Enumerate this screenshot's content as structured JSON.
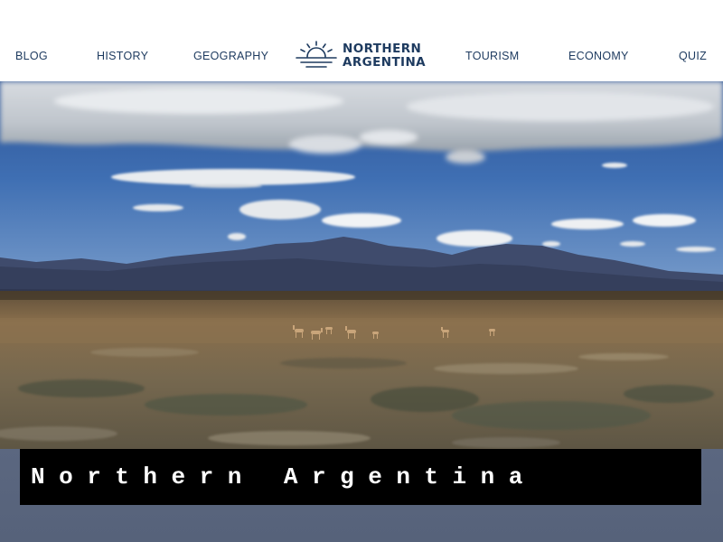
{
  "nav": {
    "blog": "BLOG",
    "history": "HISTORY",
    "geography": "GEOGRAPHY",
    "tourism": "TOURISM",
    "economy": "ECONOMY",
    "quiz": "QUIZ"
  },
  "logo": {
    "line1": "NORTHERN",
    "line2": "ARGENTINA",
    "icon": "sunrise-icon"
  },
  "hero": {
    "title": "Northern Argentina"
  },
  "colors": {
    "brand": "#1d3a5f",
    "banner": "#5b6780",
    "title_box": "#000000",
    "title_text": "#ffffff"
  }
}
